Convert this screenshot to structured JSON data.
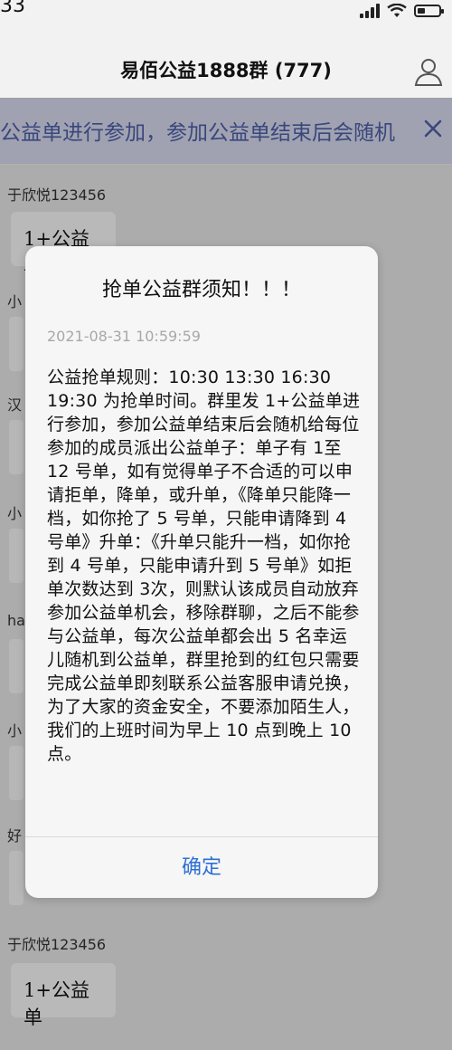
{
  "status": {
    "time": "33"
  },
  "header": {
    "title": "易佰公益1888群 (777)"
  },
  "announcement": {
    "text": "公益单进行参加，参加公益单结束后会随机"
  },
  "chat": {
    "top_sender": "于欣悦123456",
    "top_bubble": "1+公益单",
    "side_stubs": [
      "小",
      "汉",
      "小",
      "ha",
      "小",
      "好"
    ],
    "bottom_sender": "于欣悦123456",
    "bottom_bubble": "1+公益单"
  },
  "dialog": {
    "title": "抢单公益群须知！！！",
    "date": "2021-08-31 10:59:59",
    "body": "公益抢单规则：10:30 13:30 16:30 19:30 为抢单时间。群里发 1+公益单进行参加，参加公益单结束后会随机给每位参加的成员派出公益单子：单子有 1至 12 号单，如有觉得单子不合适的可以申请拒单，降单，或升单，《降单只能降一档，如你抢了 5 号单，只能申请降到 4 号单》升单：《升单只能升一档，如你抢到 4 号单，只能申请升到 5 号单》如拒单次数达到 3次，则默认该成员自动放弃参加公益单机会，移除群聊，之后不能参与公益单，每次公益单都会出 5 名幸运儿随机到公益单，群里抢到的红包只需要完成公益单即刻联系公益客服申请兑换，为了大家的资金安全，不要添加陌生人，我们的上班时间为早上 10 点到晚上 10 点。",
    "confirm_label": "确定"
  }
}
